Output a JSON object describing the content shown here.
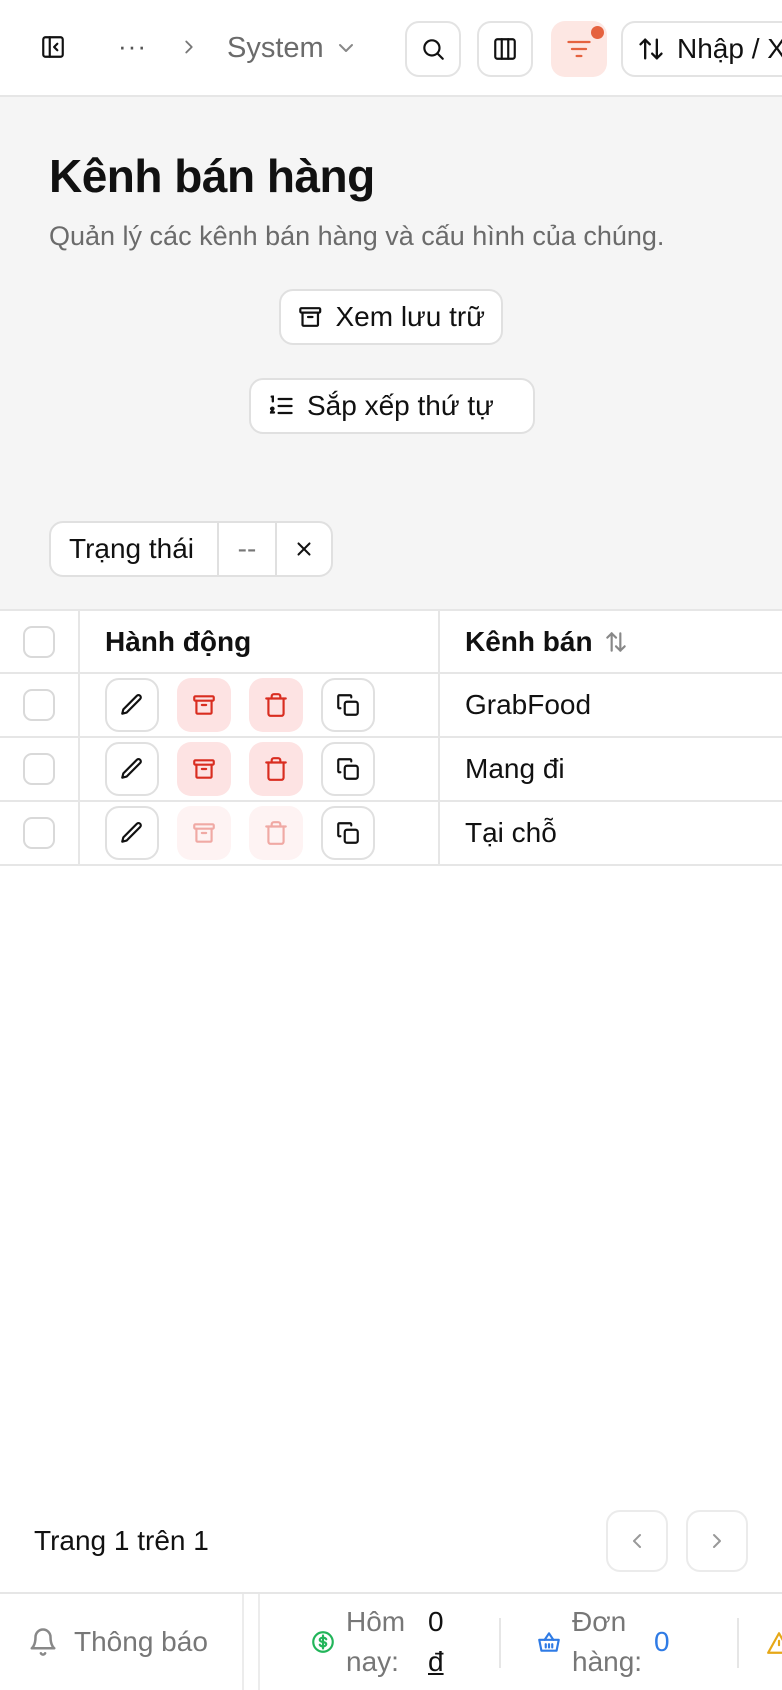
{
  "toolbar": {
    "more_label": "···",
    "breadcrumb_current": "System",
    "import_export_label": "Nhập / X",
    "icons": [
      "sidebar-toggle-icon",
      "chevron-right-icon",
      "chevron-down-icon",
      "search-icon",
      "columns-icon",
      "filter-icon",
      "sort-arrows-icon"
    ],
    "filter_active_color": "#e5623f"
  },
  "header": {
    "title": "Kênh bán hàng",
    "subtitle": "Quản lý các kênh bán hàng và cấu hình của chúng.",
    "archive_button": "Xem lưu trữ",
    "sort_order_button": "Sắp xếp thứ tự"
  },
  "filter": {
    "label": "Trạng thái",
    "value": "--"
  },
  "table": {
    "columns": [
      "Hành động",
      "Kênh bán"
    ],
    "rows": [
      {
        "channel": "GrabFood",
        "archive_enabled": true
      },
      {
        "channel": "Mang đi",
        "archive_enabled": true
      },
      {
        "channel": "Tại chỗ",
        "archive_enabled": false
      }
    ],
    "danger_color": "#d92d20"
  },
  "pagination": {
    "text": "Trang 1 trên 1"
  },
  "statusbar": {
    "notifications_label": "Thông báo",
    "today_label_1": "Hôm",
    "today_label_2": "nay:",
    "today_value": "0",
    "today_currency": "đ",
    "orders_label_1": "Đơn",
    "orders_label_2": "hàng:",
    "orders_value": "0",
    "orders_value_color": "#2f7be5",
    "money_icon_color": "#22b55a"
  }
}
